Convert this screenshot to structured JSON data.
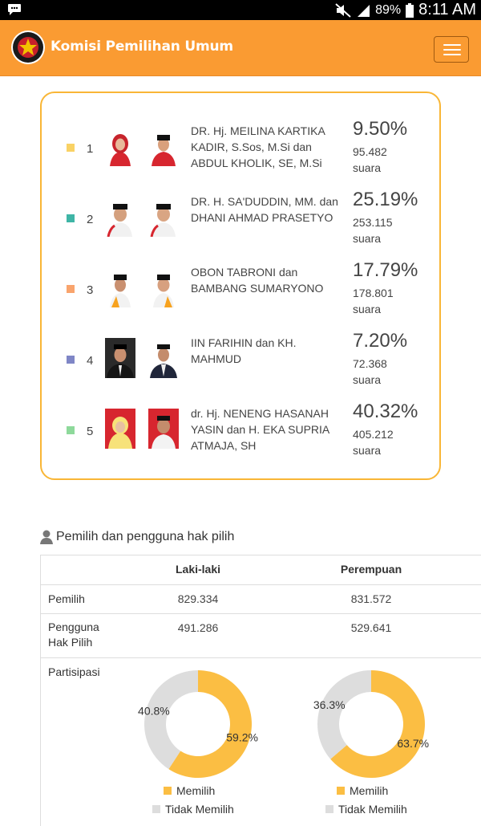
{
  "status_bar": {
    "battery": "89%",
    "time": "8:11 AM"
  },
  "header": {
    "brand": "Komisi Pemilihan Umum",
    "colors": {
      "navbar": "#fa9b32"
    }
  },
  "candidates": [
    {
      "number": "1",
      "name": "DR. Hj. MEILINA KARTIKA KADIR, S.Sos, M.Si dan ABDUL KHOLIK, SE, M.Si",
      "percent": "9.50%",
      "votes": "95.482 suara",
      "color": "#f9d265"
    },
    {
      "number": "2",
      "name": "DR. H. SA'DUDDIN, MM. dan DHANI AHMAD PRASETYO",
      "percent": "25.19%",
      "votes": "253.115 suara",
      "color": "#3fb5a6"
    },
    {
      "number": "3",
      "name": "OBON TABRONI dan BAMBANG SUMARYONO",
      "percent": "17.79%",
      "votes": "178.801 suara",
      "color": "#f9a46d"
    },
    {
      "number": "4",
      "name": "IIN FARIHIN dan KH. MAHMUD",
      "percent": "7.20%",
      "votes": "72.368 suara",
      "color": "#7f86c6"
    },
    {
      "number": "5",
      "name": "dr. Hj. NENENG HASANAH YASIN dan H. EKA SUPRIA ATMAJA, SH",
      "percent": "40.32%",
      "votes": "405.212 suara",
      "color": "#8ed99b"
    }
  ],
  "voters": {
    "title": "Pemilih dan pengguna hak pilih",
    "columns": [
      "",
      "Laki-laki",
      "Perempuan"
    ],
    "rows": [
      {
        "label": "Pemilih",
        "male": "829.334",
        "female": "831.572"
      },
      {
        "label": "Pengguna Hak Pilih",
        "male": "491.286",
        "female": "529.641"
      }
    ],
    "participation_label": "Partisipasi",
    "legend": {
      "voted": "Memilih",
      "not_voted": "Tidak Memilih"
    },
    "colors": {
      "voted": "#fbbe43",
      "not_voted": "#dddddd"
    }
  },
  "chart_data": [
    {
      "type": "pie",
      "title": "",
      "categories": [
        "Memilih",
        "Tidak Memilih"
      ],
      "values": [
        59.2,
        40.8
      ],
      "labels": [
        "59.2%",
        "40.8%"
      ]
    },
    {
      "type": "pie",
      "title": "",
      "categories": [
        "Memilih",
        "Tidak Memilih"
      ],
      "values": [
        63.7,
        36.3
      ],
      "labels": [
        "63.7%",
        "36.3%"
      ]
    }
  ]
}
